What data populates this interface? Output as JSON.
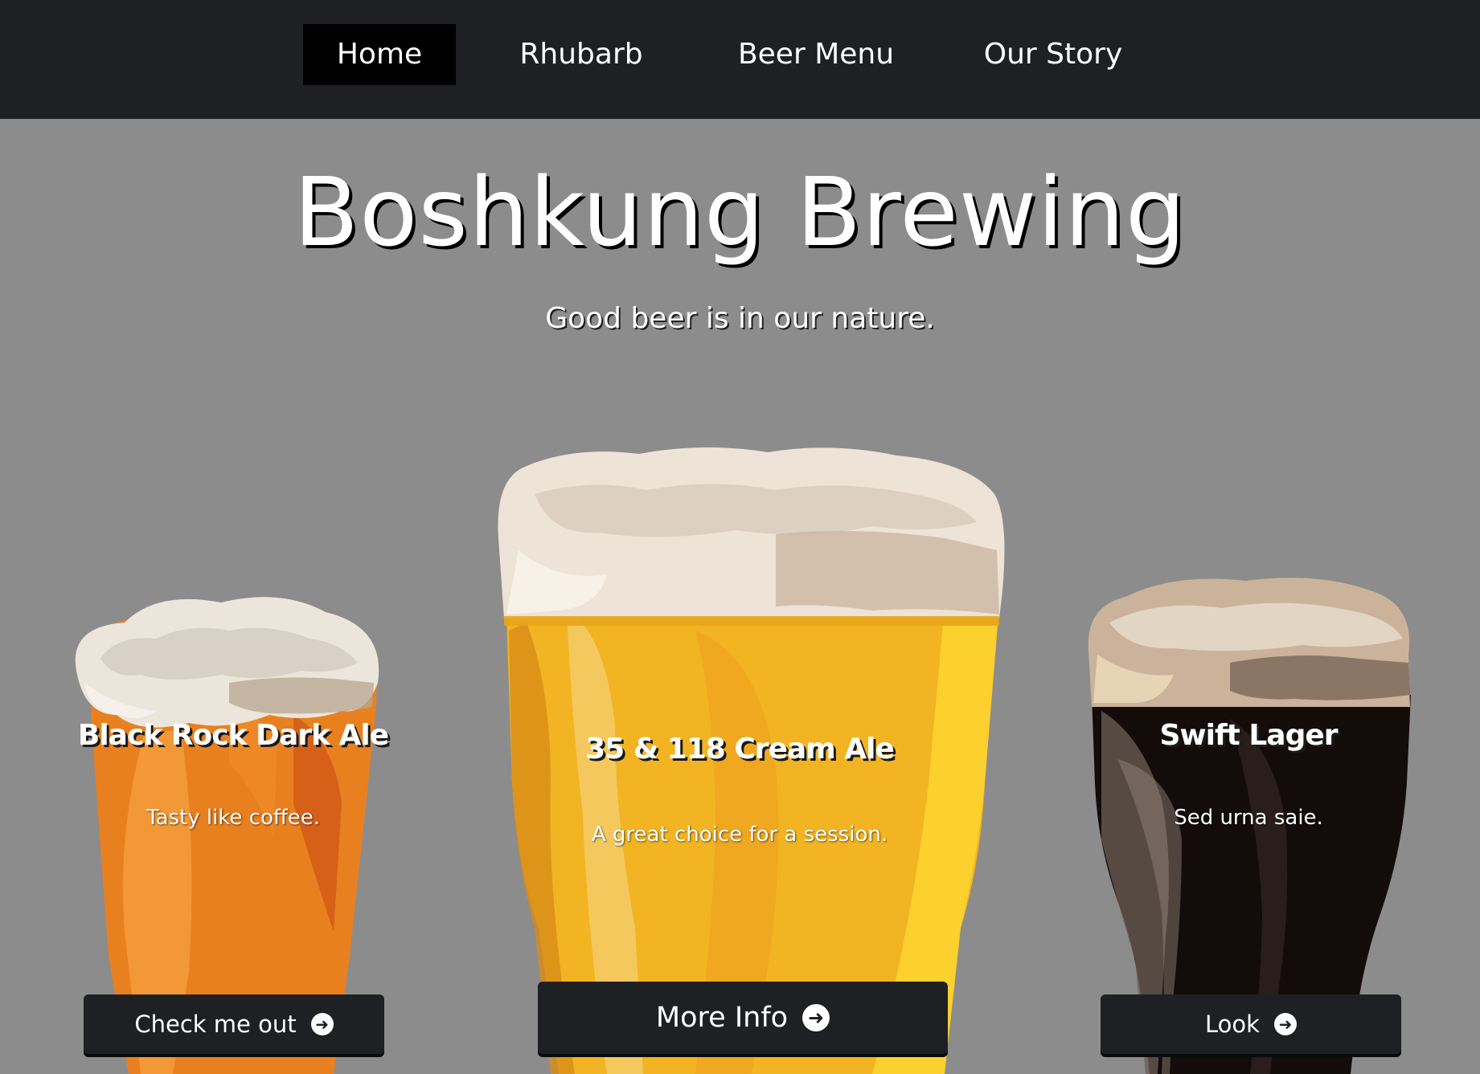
{
  "nav": {
    "items": [
      {
        "label": "Home",
        "active": true
      },
      {
        "label": "Rhubarb",
        "active": false
      },
      {
        "label": "Beer Menu",
        "active": false
      },
      {
        "label": "Our Story",
        "active": false
      }
    ]
  },
  "hero": {
    "title": "Boshkung Brewing",
    "subtitle": "Good beer is in our nature."
  },
  "beers": [
    {
      "name": "Black Rock Dark Ale",
      "description": "Tasty like coffee.",
      "button_label": "Check me out",
      "button_icon": "arrow-circle-right-icon",
      "glass_color": "#e9801f"
    },
    {
      "name": "35 & 118 Cream Ale",
      "description": "A great choice for a session.",
      "button_label": "More Info",
      "button_icon": "arrow-circle-right-icon",
      "glass_color": "#f2b422"
    },
    {
      "name": "Swift Lager",
      "description": "Sed urna saie.",
      "button_label": "Look",
      "button_icon": "arrow-circle-right-icon",
      "glass_color": "#140c0b"
    }
  ],
  "colors": {
    "background": "#8c8c8c",
    "navbar": "#1f2023",
    "nav_active": "#000000",
    "button": "#1f2023",
    "text": "#ffffff"
  }
}
